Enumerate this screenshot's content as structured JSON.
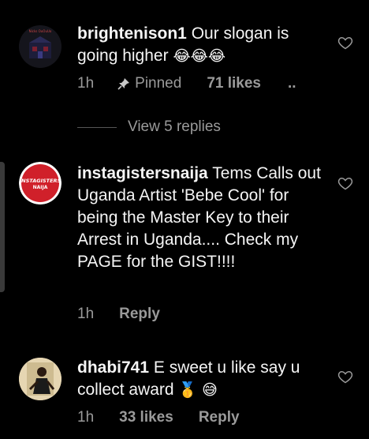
{
  "comments": [
    {
      "username": "brightenison1",
      "text": "Our slogan is going higher",
      "emoji": "😂😂😂",
      "time": "1h",
      "pinned_label": "Pinned",
      "likes": "71 likes",
      "more": "..",
      "view_replies": "View 5 replies",
      "avatar_caption": "Nicks OuOuUo"
    },
    {
      "username": "instagistersnaija",
      "text": "Tems Calls out Uganda Artist 'Bebe Cool' for being the Master Key to their Arrest in Uganda.... Check my PAGE for the GIST!!!!",
      "time": "1h",
      "reply": "Reply",
      "avatar_text_1": "INSTAGISTERS",
      "avatar_text_2": "NAIJA"
    },
    {
      "username": "dhabi741",
      "text": "E sweet u like say u collect award",
      "emoji": "🥇 😅",
      "time": "1h",
      "likes": "33 likes",
      "reply": "Reply"
    }
  ],
  "colors": {
    "background": "#000000",
    "text": "#f5f5f5",
    "muted": "#9a9a9a",
    "insta_red": "#d0202a"
  }
}
